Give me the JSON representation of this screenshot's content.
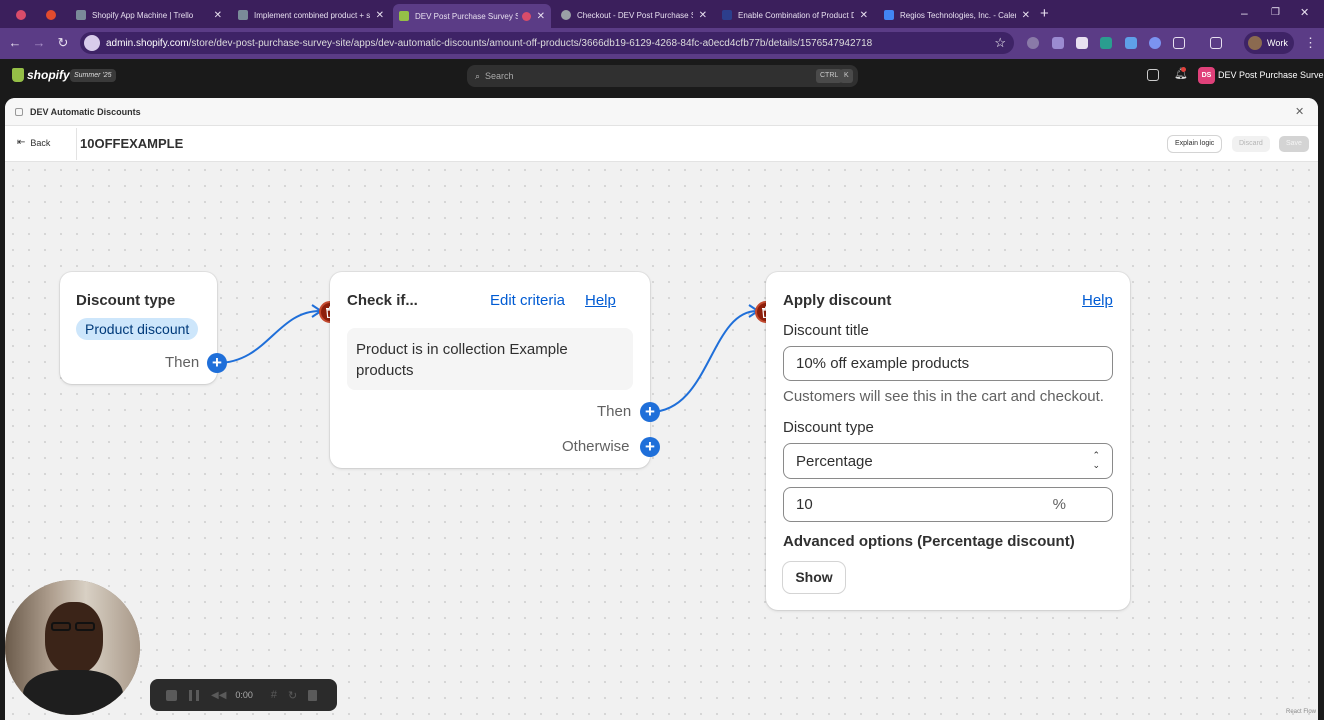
{
  "browser": {
    "tabs": [
      {
        "label": "",
        "color": "#d94c6a"
      },
      {
        "label": "",
        "color": "#e24b2e"
      },
      {
        "label": "Shopify App Machine | Trello",
        "color": "#7a8b99"
      },
      {
        "label": "Implement combined product + s",
        "color": "#7a8b99"
      },
      {
        "label": "DEV Post Purchase Survey Site",
        "color": "#95bf47"
      },
      {
        "label": "Checkout - DEV Post Purchase Su",
        "color": "#9aa0a6"
      },
      {
        "label": "Enable Combination of Product Di",
        "color": "#2c3e8c"
      },
      {
        "label": "Regios Technologies, Inc. - Calend",
        "color": "#4285f4"
      }
    ],
    "new_tab_label": "+",
    "url_host": "admin.shopify.com",
    "url_path": "/store/dev-post-purchase-survey-site/apps/dev-automatic-discounts/amount-off-products/3666db19-6129-4268-84fc-a0ecd4cfb77b/details/1576547942718",
    "profile_label": "Work"
  },
  "shopify": {
    "logo": "shopify",
    "edition_badge": "Summer '25",
    "search_placeholder": "Search",
    "shortcut_ctrl": "CTRL",
    "shortcut_k": "K",
    "store_initials": "DS",
    "store_name": "DEV Post Purchase Surve..."
  },
  "app": {
    "title": "DEV Automatic Discounts",
    "back_label": "Back",
    "discount_code": "10OFFEXAMPLE",
    "explain_label": "Explain logic",
    "discard_label": "Discard",
    "save_label": "Save"
  },
  "flow": {
    "node1": {
      "title": "Discount type",
      "pill": "Product discount",
      "then_label": "Then"
    },
    "node2": {
      "title": "Check if...",
      "edit_label": "Edit criteria",
      "help_label": "Help",
      "condition": "Product is in collection Example products",
      "then_label": "Then",
      "otherwise_label": "Otherwise"
    },
    "node3": {
      "title": "Apply discount",
      "help_label": "Help",
      "discount_title_label": "Discount title",
      "discount_title_value": "10% off example products",
      "discount_title_help": "Customers will see this in the cart and checkout.",
      "discount_type_label": "Discount type",
      "discount_type_value": "Percentage",
      "amount_value": "10",
      "amount_suffix": "%",
      "advanced_label": "Advanced options (Percentage discount)",
      "show_label": "Show"
    },
    "attribution": "React Flow"
  },
  "recorder": {
    "time": "0:00"
  },
  "colors": {
    "accent": "#005bd3",
    "connector": "#1f6fd9",
    "delete": "#8e1f0b",
    "browser": "#5b3c86"
  }
}
